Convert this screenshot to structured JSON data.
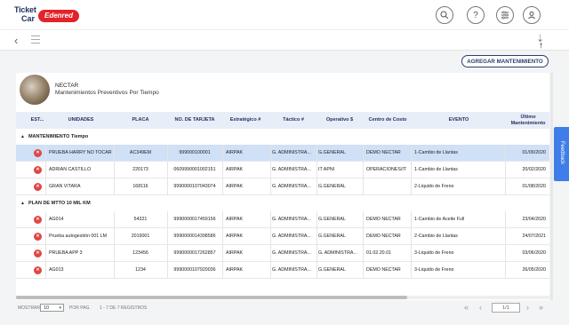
{
  "brand": {
    "line1": "Ticket",
    "line2": "Car",
    "badge": "Edenred"
  },
  "header": {
    "icons": [
      "search-icon",
      "help-icon",
      "settings-icon",
      "user-icon"
    ],
    "help_glyph": "?"
  },
  "toolbar": {
    "download_glyph": "⇣",
    "sort_glyph": "↑",
    "agregar_label": "AGREGAR MANTENIMIENTO"
  },
  "profile": {
    "name": "NECTAR",
    "subtitle": "Mantenimientos Preventivos Por Tiempo"
  },
  "columns": [
    "EST...",
    "UNIDADES",
    "PLACA",
    "NO. DE TARJETA",
    "Estratégico #",
    "Táctico #",
    "Operativo $",
    "Centro de Costo",
    "EVENTO",
    "Último Mantenimiento"
  ],
  "groups": [
    {
      "title": "MANTENIMIENTO Tiempo",
      "rows": [
        {
          "unidad": "PRUEBA HARRY NO TOCAR",
          "placa": "AC349EM",
          "tarjeta": "999000100001",
          "estrategico": "AIRPAK",
          "tactico": "G. ADMINISTRA...",
          "operativo": "G.GENERAL",
          "centro": "DEMO NECTAR",
          "evento": "1-Cambio de Llantas",
          "ultimo": "01/09/2020",
          "selected": true
        },
        {
          "unidad": "ADRIAN CASTILLO",
          "placa": "220173",
          "tarjeta": "0609990001002151",
          "estrategico": "AIRPAK",
          "tactico": "G. ADMINISTRA...",
          "operativo": "IT APNI",
          "centro": "OPERACIONES/IT",
          "evento": "1-Cambio de Llantas",
          "ultimo": "20/02/2020",
          "selected": false
        },
        {
          "unidad": "GRAN VITARA",
          "placa": "168116",
          "tarjeta": "9990000107043074",
          "estrategico": "AIRPAK",
          "tactico": "G. ADMINISTRA...",
          "operativo": "G.GENERAL",
          "centro": "",
          "evento": "2-Liquido de Freno",
          "ultimo": "01/08/2020",
          "selected": false
        }
      ]
    },
    {
      "title": "PLAN DE MTTO 10 MIL KM",
      "rows": [
        {
          "unidad": "AG014",
          "placa": "54321",
          "tarjeta": "9990000017459156",
          "estrategico": "AIRPAK",
          "tactico": "G. ADMINISTRA...",
          "operativo": "G.GENERAL",
          "centro": "DEMO NECTAR",
          "evento": "1-Cambio de Aceite Full",
          "ultimo": "23/04/2020",
          "selected": false
        },
        {
          "unidad": "Prueba autogestión 001 LM",
          "placa": "2019001",
          "tarjeta": "9990000014398586",
          "estrategico": "AIRPAK",
          "tactico": "G. ADMINISTRA...",
          "operativo": "G.GENERAL",
          "centro": "DEMO NECTAR",
          "evento": "2-Cambio de Llantas",
          "ultimo": "24/07/2021",
          "selected": false
        },
        {
          "unidad": "PRUEBA APP 3",
          "placa": "123456",
          "tarjeta": "9990000017262857",
          "estrategico": "AIRPAK",
          "tactico": "G. ADMINISTRA...",
          "operativo": "G. ADMINISTRA...",
          "centro": "01.02.20.01",
          "evento": "3-Liquido de Freno",
          "ultimo": "03/06/2020",
          "selected": false
        },
        {
          "unidad": "AG013",
          "placa": "1234",
          "tarjeta": "9990000107920036",
          "estrategico": "AIRPAK",
          "tactico": "G. ADMINISTRA...",
          "operativo": "G.GENERAL",
          "centro": "DEMO NECTAR",
          "evento": "3-Liquido de Freno",
          "ultimo": "26/05/2020",
          "selected": false
        }
      ]
    }
  ],
  "footer": {
    "mostrar": "MOSTRAR",
    "page_size": "10",
    "por_pag": "POR PAG.",
    "range": "1 - 7 DE 7 REGISTROS",
    "page_indicator": "1/1",
    "first": "«",
    "prev": "‹",
    "next": "›",
    "last": "»"
  },
  "feedback": "Feedback",
  "row_delete_glyph": "✕",
  "colors": {
    "primary": "#2c3e6e",
    "selected_row": "#cfe0f7",
    "delete": "#e04646",
    "feedback": "#3f7ee8",
    "brand_red": "#e2232a"
  }
}
